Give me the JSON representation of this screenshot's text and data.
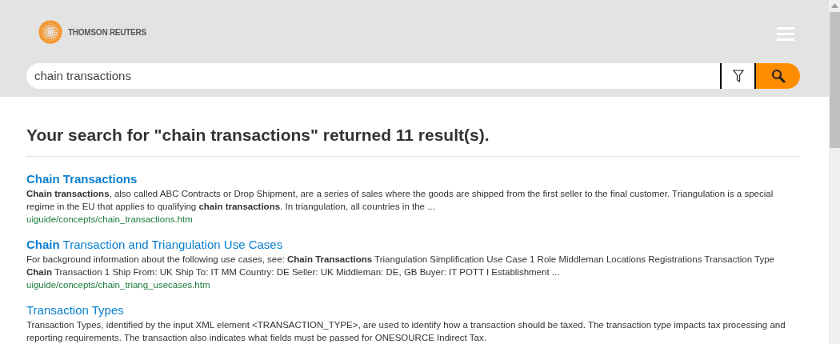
{
  "header": {
    "logo_text": "THOMSON REUTERS",
    "search": {
      "value": "chain transactions"
    }
  },
  "summary": "Your search for \"chain transactions\" returned 11 result(s).",
  "results": [
    {
      "title": "Chain Transactions",
      "snippet": "**Chain transactions**, also called ABC Contracts or Drop Shipment, are a series of sales where the goods are shipped from the first seller to the final customer. Triangulation is a special regime in the EU that applies to qualifying **chain transactions**. In triangulation, all countries in the ...",
      "url": "uiguide/concepts/chain_transactions.htm"
    },
    {
      "title": "**Chain** Transaction and Triangulation Use Cases",
      "snippet": "For background information about the following use cases, see: **Chain Transactions** Triangulation Simplification Use Case 1 Role Middleman Locations Registrations Transaction Type **Chain** Transaction 1 Ship From: UK Ship To: IT MM Country: DE Seller: UK Middleman: DE, GB Buyer: IT POTT I Establishment ...",
      "url": "uiguide/concepts/chain_triang_usecases.htm"
    },
    {
      "title": "Transaction Types",
      "snippet": "Transaction Types, identified by the input XML element <TRANSACTION_TYPE>, are used to identify how a transaction should be taxed. The transaction type impacts tax processing and reporting requirements. The transaction also indicates what fields must be passed for ONESOURCE Indirect Tax."
    }
  ]
}
